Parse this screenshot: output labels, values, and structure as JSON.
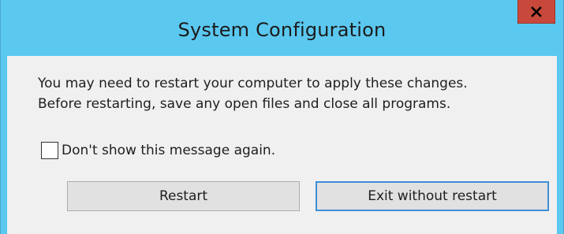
{
  "window": {
    "title": "System Configuration"
  },
  "titlebar": {
    "close_icon": "close-icon"
  },
  "message": {
    "line1": "You may need to restart your computer to apply these changes.",
    "line2": "Before restarting, save any open files and close all programs."
  },
  "checkbox": {
    "label": "Don't show this message again.",
    "checked": false
  },
  "buttons": {
    "restart": "Restart",
    "exit_without_restart": "Exit without restart"
  },
  "colors": {
    "titlebar": "#5bc8f0",
    "close_button": "#c9483c",
    "client_area": "#f0f0f0",
    "focused_button_border": "#3c8fd6"
  }
}
